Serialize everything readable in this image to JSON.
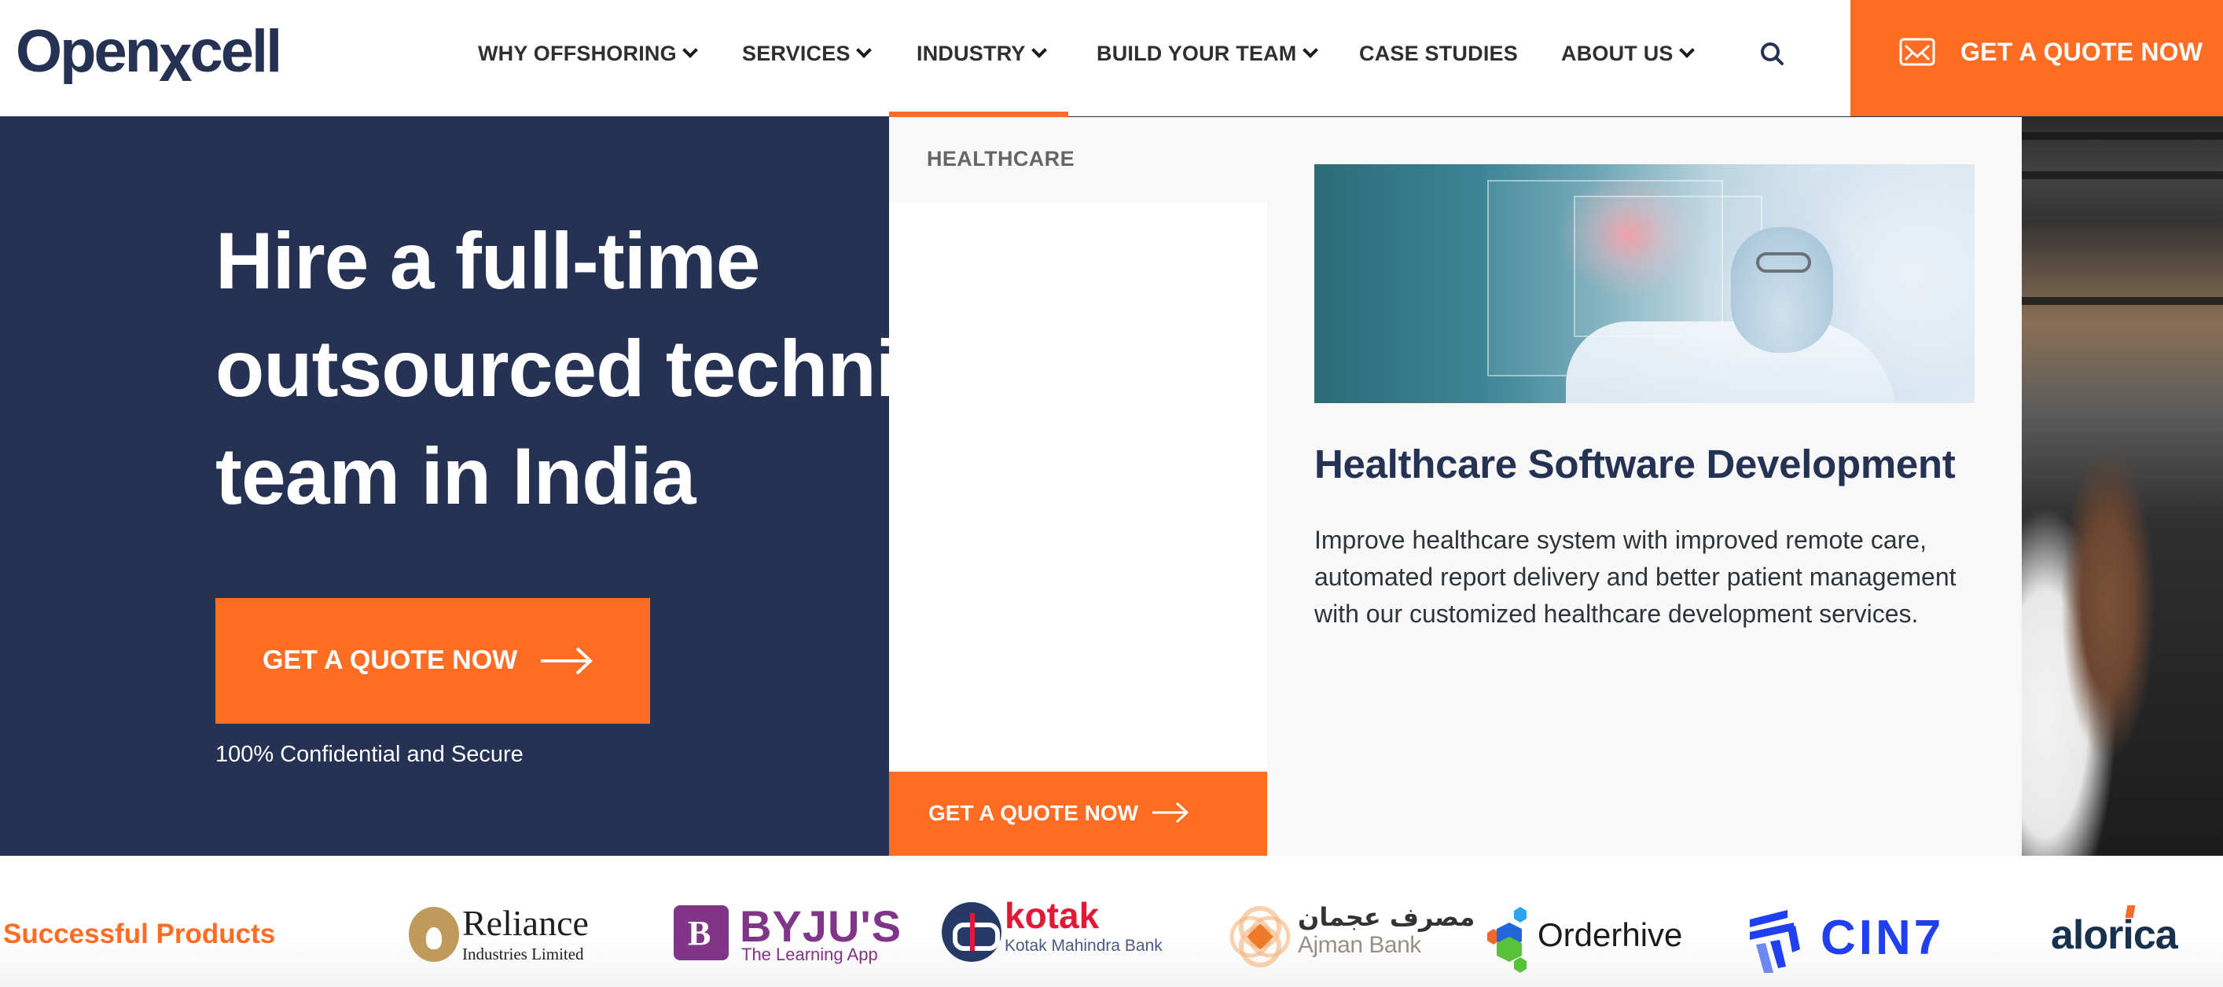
{
  "header": {
    "logo_text_pre": "Open",
    "logo_text_x": "x",
    "logo_text_post": "cell",
    "nav": [
      {
        "label": "WHY OFFSHORING",
        "has_dropdown": true
      },
      {
        "label": "SERVICES",
        "has_dropdown": true
      },
      {
        "label": "INDUSTRY",
        "has_dropdown": true,
        "active": true
      },
      {
        "label": "BUILD YOUR TEAM",
        "has_dropdown": true
      },
      {
        "label": "CASE STUDIES",
        "has_dropdown": false
      },
      {
        "label": "ABOUT US",
        "has_dropdown": true
      }
    ],
    "search_icon": "search-icon",
    "quote_button": {
      "label": "GET A QUOTE NOW",
      "icon": "mail-icon"
    }
  },
  "hero": {
    "title_lines": [
      "Hire a full-time",
      "outsourced technical",
      "team in India"
    ],
    "cta_label": "GET A QUOTE NOW",
    "cta_icon": "arrow-right-icon",
    "caption": "100% Confidential and Secure"
  },
  "dropdown": {
    "active_category": "HEALTHCARE",
    "cta_label": "GET A QUOTE NOW",
    "cta_icon": "arrow-right-icon",
    "feature": {
      "image_alt": "Doctor interacting with holographic medical interface",
      "title": "Healthcare Software Development",
      "description": "Improve healthcare system with improved remote care, automated report delivery and better patient management with our customized healthcare development services."
    }
  },
  "clients": {
    "title": "Successful Products",
    "logos": [
      {
        "name": "Reliance",
        "subtitle": "Industries Limited"
      },
      {
        "name": "BYJU'S",
        "subtitle": "The Learning App",
        "mark": "B"
      },
      {
        "name": "kotak",
        "subtitle": "Kotak Mahindra Bank"
      },
      {
        "name": "Ajman Bank",
        "arabic": "مصرف عجمان"
      },
      {
        "name": "Orderhive"
      },
      {
        "name": "CIN7"
      },
      {
        "name": "alorica"
      }
    ]
  },
  "colors": {
    "brand_orange": "#ff6c24",
    "brand_navy": "#253254",
    "dropdown_bg": "#f8f8f8"
  }
}
